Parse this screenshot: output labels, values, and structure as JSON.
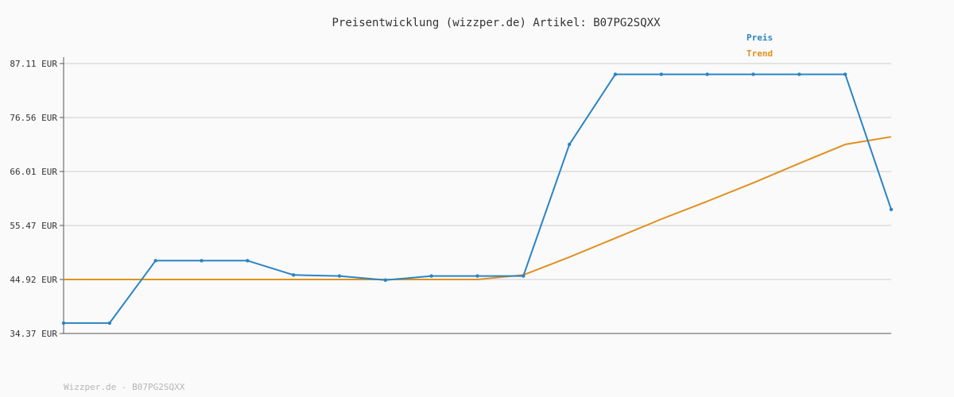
{
  "chart_data": {
    "type": "line",
    "title": "Preisentwicklung (wizzper.de) Artikel: B07PG2SQXX",
    "xlabel": "",
    "ylabel": "",
    "ylim": [
      34.37,
      87.11
    ],
    "yticks": [
      34.37,
      44.92,
      55.47,
      66.01,
      76.56,
      87.11
    ],
    "ytick_labels": [
      "34.37 EUR",
      "44.92 EUR",
      "55.47 EUR",
      "66.01 EUR",
      "76.56 EUR",
      "87.11 EUR"
    ],
    "grid": true,
    "legend_position": "top-right",
    "series": [
      {
        "name": "Preis",
        "color": "#2a84c4",
        "markers": true,
        "values": [
          36.4,
          36.4,
          48.6,
          48.6,
          48.6,
          45.8,
          45.6,
          44.8,
          45.6,
          45.6,
          45.6,
          71.3,
          85.0,
          85.0,
          85.0,
          85.0,
          85.0,
          85.0,
          58.6
        ]
      },
      {
        "name": "Trend",
        "color": "#e0901e",
        "markers": false,
        "values": [
          44.92,
          44.92,
          44.92,
          44.92,
          44.92,
          44.92,
          44.92,
          44.92,
          44.92,
          44.92,
          45.8,
          49.3,
          53.0,
          56.7,
          60.2,
          63.8,
          67.6,
          71.3,
          72.8
        ]
      }
    ]
  },
  "footer": {
    "text": "Wizzper.de - B07PG2SQXX"
  }
}
